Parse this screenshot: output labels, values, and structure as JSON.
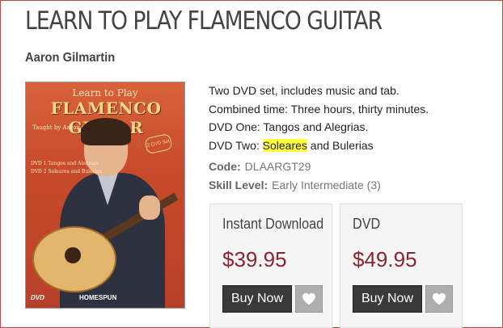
{
  "product": {
    "title": "LEARN TO PLAY FLAMENCO GUITAR",
    "author": "Aaron Gilmartin",
    "cover": {
      "top_text": "Learn to Play",
      "title_text": "FLAMENCO GUITAR",
      "taught_by": "Taught by Aaron Gilmartin",
      "list_line1": "DVD 1 Tangos and Alegrias",
      "list_line2": "DVD 2 Soleares and Bulerias",
      "badge": "2 DVD Set",
      "dvd_logo": "DVD",
      "brand": "HOMESPUN"
    },
    "description": {
      "line1": "Two DVD set, includes music and tab.",
      "line2": "Combined time: Three hours, thirty minutes.",
      "line3": "DVD One: Tangos and Alegrias.",
      "line4_prefix": "DVD Two: ",
      "line4_highlight": "Soleares",
      "line4_suffix": " and Bulerias"
    },
    "code_label": "Code:",
    "code_value": "DLAARGT29",
    "skill_label": "Skill Level:",
    "skill_value": "Early Intermediate (3)"
  },
  "purchase_options": [
    {
      "title": "Instant Download",
      "price": "$39.95",
      "buy_label": "Buy Now",
      "wishlist_icon": "heart-icon"
    },
    {
      "title": "DVD",
      "price": "$49.95",
      "buy_label": "Buy Now",
      "wishlist_icon": "heart-icon"
    }
  ],
  "colors": {
    "price": "#8b2330",
    "button_dark": "#3a3a3a",
    "highlight": "#ffff3b",
    "frame_border": "#b94a48"
  }
}
